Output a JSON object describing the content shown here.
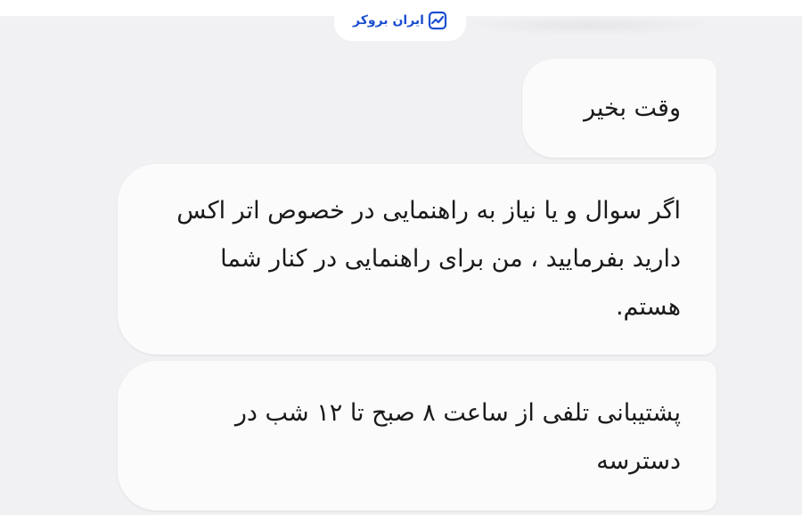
{
  "brand": {
    "name": "ایران بروکر",
    "logo_icon": "trend-chart-icon",
    "color": "#1d4fd1"
  },
  "messages": [
    {
      "text": "وقت بخیر"
    },
    {
      "text": "اگر سوال و یا نیاز به راهنمایی در خصوص اتر اکس دارید بفرمایید ، من برای راهنمایی در کنار شما هستم."
    },
    {
      "text": "پشتیبانی تلفی از ساعت ۸ صبح تا ۱۲ شب در دسترسه"
    }
  ]
}
